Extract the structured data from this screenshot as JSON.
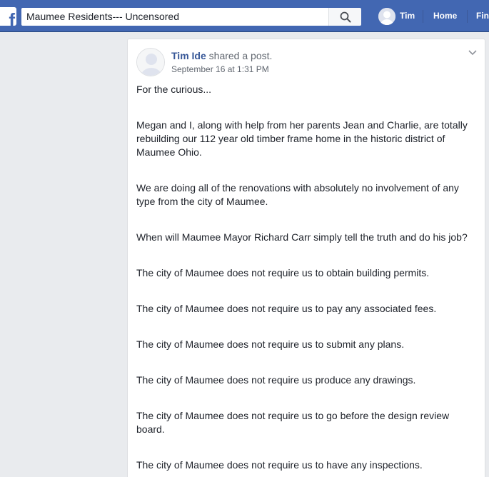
{
  "header": {
    "logo_letter": "f",
    "search_value": "Maumee Residents--- Uncensored",
    "user_name": "Tim",
    "home_label": "Home",
    "find_label": "Fin"
  },
  "post": {
    "author": "Tim Ide",
    "action": " shared a post.",
    "timestamp": "September 16 at 1:31 PM",
    "paragraphs": [
      "For the curious...",
      "Megan and I, along with help from her parents Jean and Charlie, are totally rebuilding our 112 year old timber frame home in the historic district of Maumee Ohio.",
      "We are doing all of the renovations with absolutely no involvement of any type from the city of Maumee.",
      "When will Maumee Mayor Richard Carr simply tell the truth and do his job?",
      "The city of Maumee does not require us to obtain building permits.",
      "The city of Maumee does not require us to pay any associated fees.",
      "The city of Maumee does not require us to submit any plans.",
      "The city of Maumee does not require us produce any drawings.",
      "The city of Maumee does not require us to go before the design review board.",
      "The city of Maumee does not require us to have any inspections."
    ]
  },
  "colors": {
    "brand": "#4267b2",
    "link": "#385898",
    "background": "#e9ebee"
  }
}
